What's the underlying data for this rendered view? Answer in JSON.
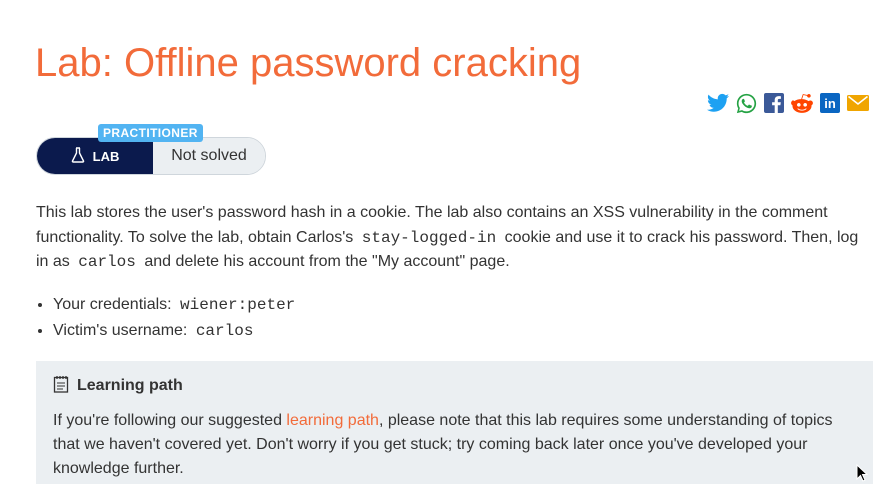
{
  "header": {
    "title": "Lab: Offline password cracking"
  },
  "share": {
    "icons": [
      "twitter-icon",
      "whatsapp-icon",
      "facebook-icon",
      "reddit-icon",
      "linkedin-icon",
      "email-icon"
    ],
    "linkedin_text": "in"
  },
  "badge": {
    "level": "PRACTITIONER",
    "lab_label": "LAB",
    "status": "Not solved"
  },
  "description": {
    "part1": "This lab stores the user's password hash in a cookie. The lab also contains an XSS vulnerability in the comment functionality. To solve the lab, obtain Carlos's",
    "cookie_name": "stay-logged-in",
    "part2": "cookie and use it to crack his password. Then, log in as",
    "username": "carlos",
    "part3": "and delete his account from the \"My account\" page."
  },
  "credentials": {
    "items": [
      {
        "label": "Your credentials:",
        "value": "wiener:peter"
      },
      {
        "label": "Victim's username:",
        "value": "carlos"
      }
    ]
  },
  "learning_path": {
    "heading": "Learning path",
    "text_before": "If you're following our suggested",
    "link_text": "learning path",
    "text_after": ", please note that this lab requires some understanding of topics that we haven't covered yet. Don't worry if you get stuck; try coming back later once you've developed your knowledge further."
  },
  "colors": {
    "accent": "#f26b3a",
    "navy": "#0b1a4d",
    "practitioner": "#52b4f2",
    "panel": "#ebeff2"
  }
}
